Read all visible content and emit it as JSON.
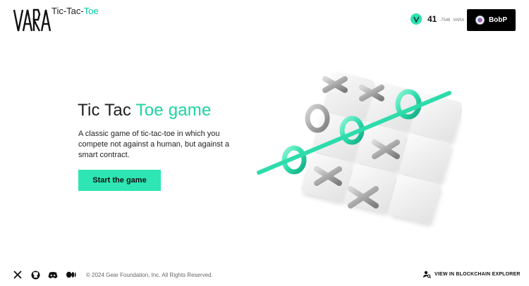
{
  "header": {
    "logo_text": "VARA",
    "app_title_part1": "Tic-Tac-",
    "app_title_part2": "Toe",
    "balance": {
      "integer": "41",
      "fraction": ".7546",
      "unit": "VARA"
    },
    "account": {
      "name": "BobP"
    }
  },
  "hero": {
    "title_part1": "Tic Tac ",
    "title_part2": "Toe game",
    "description": "A classic game of tic-tac-toe in which you compete not against a human, but against a smart contract.",
    "start_button": "Start the game"
  },
  "footer": {
    "social_icons": [
      "x-icon",
      "github-icon",
      "discord-icon",
      "medium-icon"
    ],
    "copyright": "© 2024 Gear Foundation, Inc. All Rights Reserved.",
    "explorer_link": "VIEW IN BLOCKCHAIN EXPLORER"
  },
  "colors": {
    "accent": "#2de6b3",
    "title_accent": "#1fd3a3",
    "account_bg": "#000000"
  }
}
